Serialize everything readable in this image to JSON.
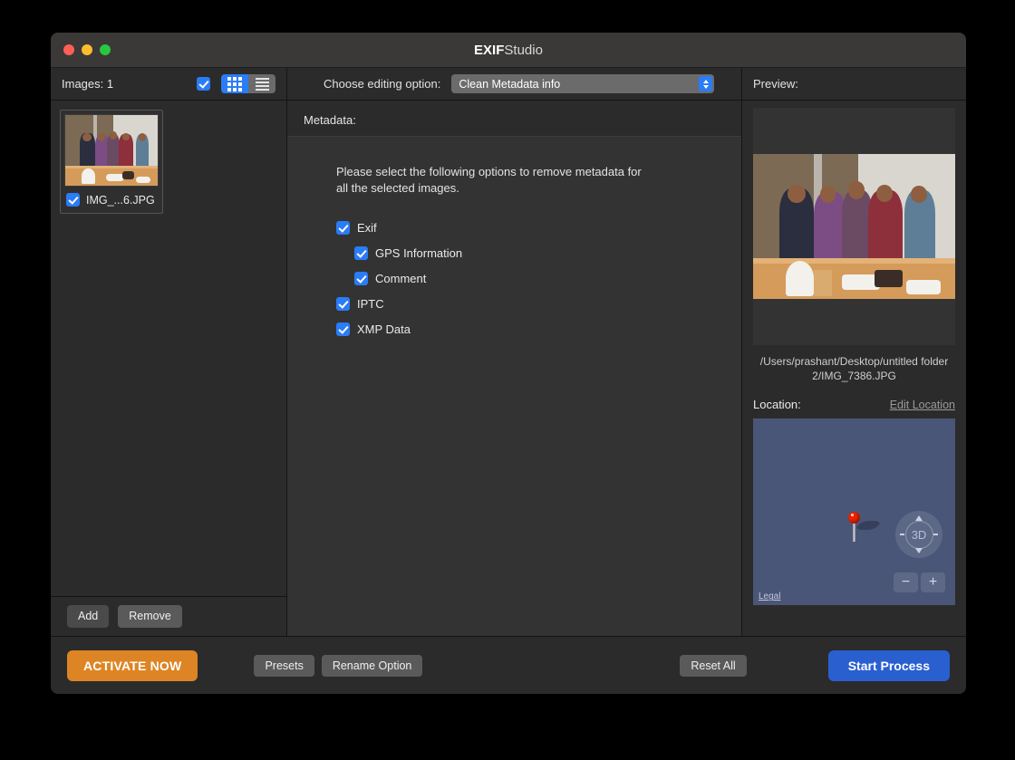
{
  "window": {
    "title_bold": "EXIF",
    "title_rest": "Studio",
    "traffic": {
      "close": "close-button",
      "minimize": "minimize-button",
      "zoom": "zoom-button"
    }
  },
  "left_panel": {
    "images_label": "Images:  1",
    "select_all_checked": true,
    "view_modes": [
      {
        "name": "grid-view",
        "active": true
      },
      {
        "name": "list-view",
        "active": false
      }
    ],
    "thumbnails": [
      {
        "filename": "IMG_...6.JPG",
        "checked": true
      }
    ],
    "buttons": {
      "add": "Add",
      "remove": "Remove"
    }
  },
  "middle_panel": {
    "editing_option_label": "Choose editing option:",
    "editing_option_value": "Clean Metadata info",
    "editing_options": [
      "Clean Metadata info"
    ],
    "metadata_label": "Metadata:",
    "instruction": "Please select the following options to remove metadata for all the selected images.",
    "options": [
      {
        "label": "Exif",
        "checked": true,
        "indent": 0
      },
      {
        "label": "GPS Information",
        "checked": true,
        "indent": 1
      },
      {
        "label": "Comment",
        "checked": true,
        "indent": 1
      },
      {
        "label": "IPTC",
        "checked": true,
        "indent": 0
      },
      {
        "label": "XMP Data",
        "checked": true,
        "indent": 0
      }
    ]
  },
  "right_panel": {
    "preview_label": "Preview:",
    "file_path": "/Users/prashant/Desktop/untitled folder 2/IMG_7386.JPG",
    "location_label": "Location:",
    "edit_location_link": "Edit Location",
    "map": {
      "compass_label": "3D",
      "zoom_out": "−",
      "zoom_in": "+",
      "legal_link": "Legal",
      "pin_color": "#ee2200",
      "background_color": "#4a5677"
    }
  },
  "toolbar": {
    "activate_label": "ACTIVATE NOW",
    "presets_label": "Presets",
    "rename_label": "Rename Option",
    "reset_label": "Reset All",
    "start_label": "Start Process"
  },
  "colors": {
    "accent_blue": "#2a7cf7",
    "activate_orange": "#dd8525",
    "start_blue": "#2a5fd0",
    "window_bg": "#2b2b2b",
    "titlebar_bg": "#3a3937"
  }
}
